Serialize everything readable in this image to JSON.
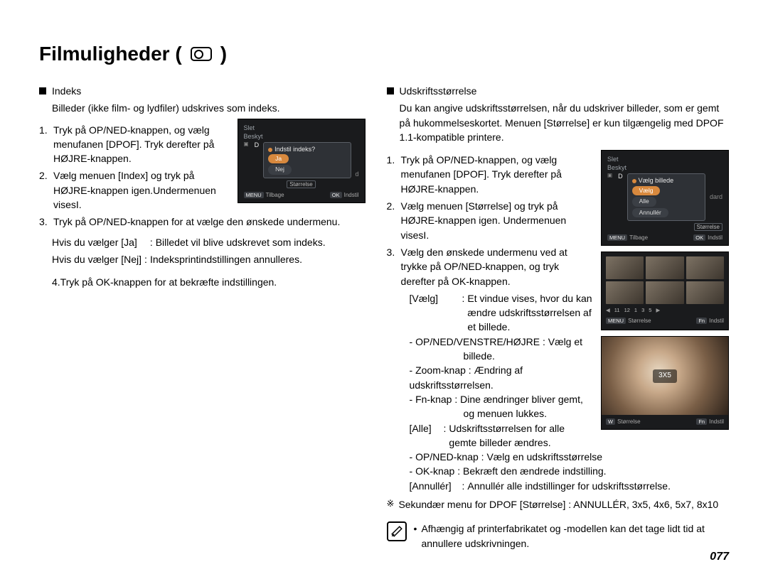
{
  "title": "Filmuligheder (",
  "title_icon": "camera-dpof-icon",
  "title_close": ")",
  "page_number": "077",
  "left": {
    "section": "Indeks",
    "intro": "Billeder (ikke film- og lydfiler) udskrives som indeks.",
    "step1": "Tryk på OP/NED-knappen, og vælg menufanen [DPOF]. Tryk derefter på HØJRE-knappen.",
    "step2": "Vælg menuen [Index] og tryk på HØJRE-knappen igen.Undermenuen visesI.",
    "step3": "Tryk på OP/NED-knappen for at vælge den ønskede undermenu.",
    "hvis_ja_label": "Hvis du vælger [Ja]",
    "hvis_ja_val": "Billedet vil blive udskrevet som indeks.",
    "hvis_nej_label": "Hvis du vælger [Nej]",
    "hvis_nej_val": "Indeksprintindstillingen annulleres.",
    "step4": "4.Tryk på OK-knappen for at bekræfte indstillingen.",
    "lcd": {
      "menu1": "Slet",
      "menu2": "Beskyt",
      "prompt": "Indstil indeks?",
      "opt_yes": "Ja",
      "opt_no": "Nej",
      "opt_extra": "Størrelse",
      "foot_left": "Tilbage",
      "foot_right": "Indstil",
      "foot_left_btn": "MENU",
      "foot_right_btn": "OK",
      "side_d": "d"
    }
  },
  "right": {
    "section": "Udskriftsstørrelse",
    "intro": "Du kan angive udskriftsstørrelsen, når du udskriver billeder, som er gemt på hukommelseskortet. Menuen [Størrelse] er kun tilgængelig med DPOF 1.1-kompatible printere.",
    "step1": "Tryk på OP/NED-knappen, og vælg menufanen [DPOF]. Tryk derefter på HØJRE-knappen.",
    "step2": "Vælg menuen [Størrelse] og tryk på HØJRE-knappen igen. Undermenuen visesI.",
    "step3": "Vælg den ønskede undermenu ved at trykke på OP/NED-knappen, og tryk derefter på OK-knappen.",
    "opt_vaelg_label": "[Vælg]",
    "opt_vaelg_val": "Et vindue vises, hvor du kan ændre udskriftsstørrelsen af et billede.",
    "sub1": "OP/NED/VENSTRE/HØJRE : Vælg et",
    "sub1b": "billede.",
    "sub2": "Zoom-knap : Ændring af udskriftsstørrelsen.",
    "sub3": "Fn-knap : Dine ændringer bliver gemt,",
    "sub3b": "og menuen lukkes.",
    "opt_alle_label": "[Alle]",
    "opt_alle_val": "Udskriftsstørrelsen for alle gemte billeder ændres.",
    "sub4": "OP/NED-knap : Vælg en udskriftsstørrelse",
    "sub5": "OK-knap : Bekræft den ændrede indstilling.",
    "opt_ann_label": "[Annullér]",
    "opt_ann_val": "Annullér alle indstillinger for udskriftsstørrelse.",
    "secondary": "Sekundær menu for DPOF [Størrelse] : ANNULLÉR, 3x5, 4x6, 5x7, 8x10",
    "note": "Afhængig af printerfabrikatet og -modellen kan det tage lidt tid at annullere udskrivningen.",
    "lcd": {
      "menu1": "Slet",
      "menu2": "Beskyt",
      "prompt": "Vælg billede",
      "opt_sel": "Vælg",
      "opt_all": "Alle",
      "opt_cancel": "Annullér",
      "foot_left": "Tilbage",
      "foot_right": "Indstil",
      "foot_left_btn": "MENU",
      "foot_right_btn": "OK",
      "side_d": "D",
      "top_label": "Størrelse",
      "side_right": "dard"
    },
    "thumbs": {
      "nums": [
        "11",
        "12",
        "1",
        "3",
        "5"
      ],
      "foot_left_btn": "MENU",
      "foot_left": "Størrelse",
      "foot_right_btn": "Fn",
      "foot_right": "Indstil"
    },
    "photo": {
      "size_tag": "3X5",
      "foot_left_btn": "W",
      "foot_left": "Størrelse",
      "foot_right_btn": "Fn",
      "foot_right": "Indstil"
    }
  }
}
